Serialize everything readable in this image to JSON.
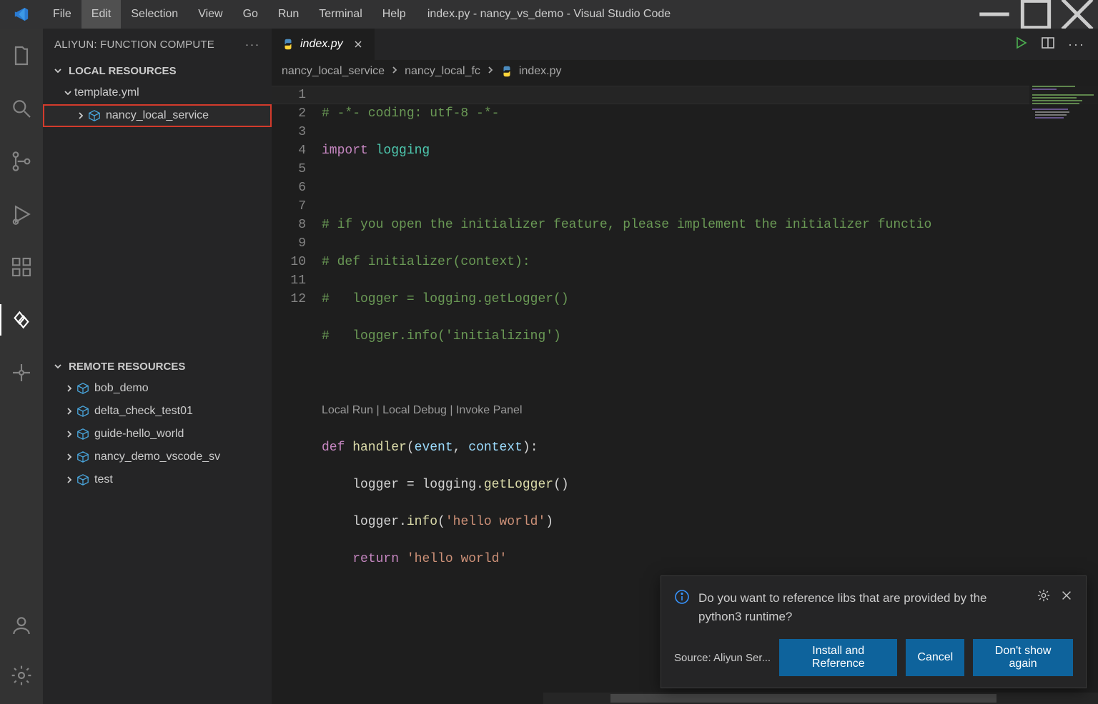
{
  "menubar": {
    "items": [
      "File",
      "Edit",
      "Selection",
      "View",
      "Go",
      "Run",
      "Terminal",
      "Help"
    ],
    "hover_index": 1
  },
  "window_title": "index.py - nancy_vs_demo - Visual Studio Code",
  "sidebar": {
    "panel_title": "ALIYUN: FUNCTION COMPUTE",
    "local_section": "LOCAL RESOURCES",
    "local_tree": {
      "templates": "template.yml",
      "service": "nancy_local_service"
    },
    "remote_section": "REMOTE RESOURCES",
    "remote_items": [
      "bob_demo",
      "delta_check_test01",
      "guide-hello_world",
      "nancy_demo_vscode_sv",
      "test"
    ]
  },
  "tab": {
    "filename": "index.py"
  },
  "breadcrumbs": {
    "seg1": "nancy_local_service",
    "seg2": "nancy_local_fc",
    "seg3": "index.py"
  },
  "codelens": "Local Run | Local Debug | Invoke Panel",
  "gutter": [
    "1",
    "2",
    "3",
    "4",
    "5",
    "6",
    "7",
    "8",
    "",
    "9",
    "10",
    "11",
    "12"
  ],
  "code": {
    "l1": "# -*- coding: utf-8 -*-",
    "l2a": "import",
    "l2b": " logging",
    "l4": "# if you open the initializer feature, please implement the initializer functio",
    "l5": "# def initializer(context):",
    "l6": "#   logger = logging.getLogger()",
    "l7": "#   logger.info('initializing')",
    "l9a": "def",
    "l9b": " handler",
    "l9c": "(",
    "l9d": "event",
    "l9e": ", ",
    "l9f": "context",
    "l9g": "):",
    "l10a": "    logger ",
    "l10b": "=",
    "l10c": " logging.",
    "l10d": "getLogger",
    "l10e": "()",
    "l11a": "    logger.",
    "l11b": "info",
    "l11c": "(",
    "l11d": "'hello world'",
    "l11e": ")",
    "l12a": "    ",
    "l12b": "return",
    "l12c": " ",
    "l12d": "'hello world'"
  },
  "toast": {
    "message": "Do you want to reference libs that are provided by the python3 runtime?",
    "source": "Source: Aliyun Ser...",
    "btn1": "Install and Reference",
    "btn2": "Cancel",
    "btn3": "Don't show again"
  }
}
